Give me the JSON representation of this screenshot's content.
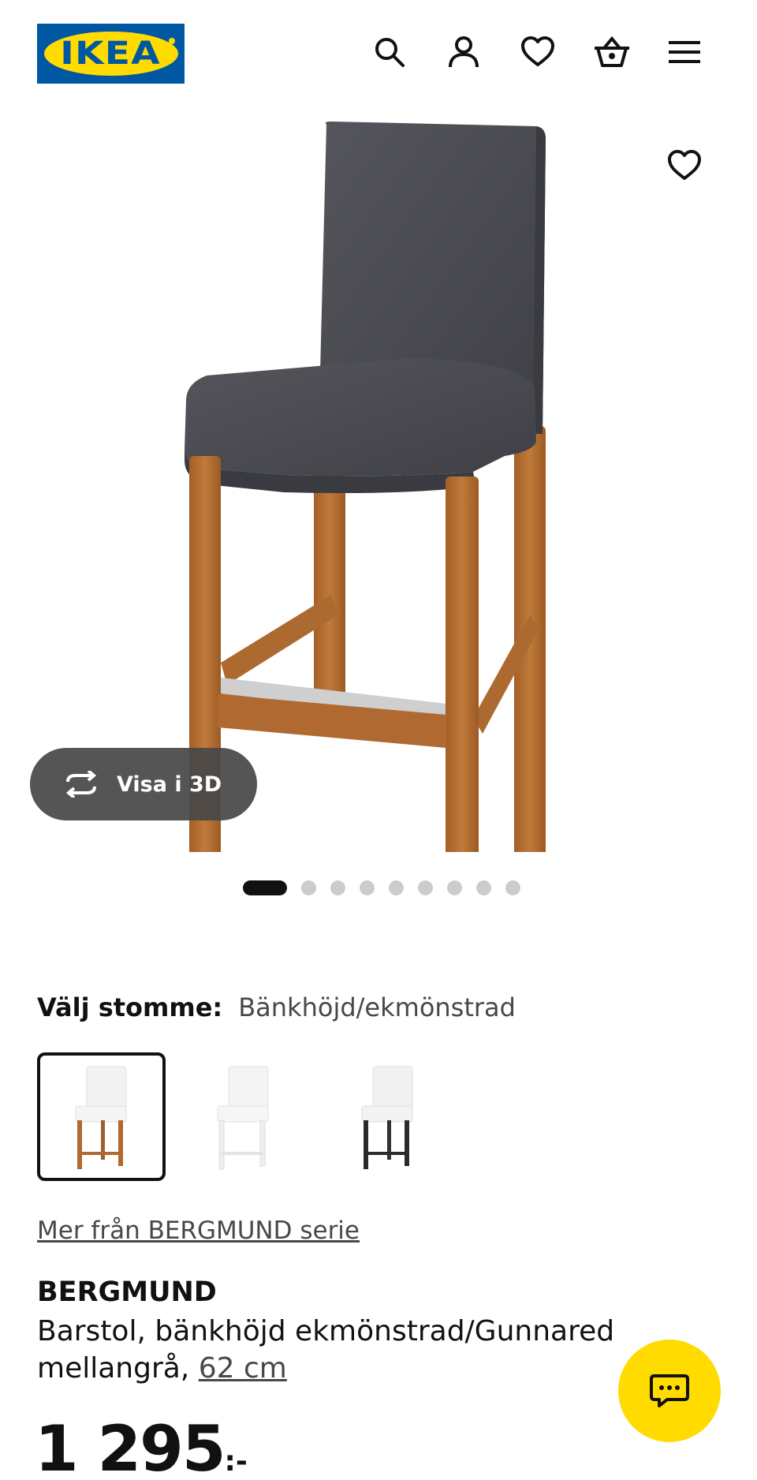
{
  "header": {
    "logo_text": "IKEA",
    "icons": [
      "search-icon",
      "account-icon",
      "heart-icon",
      "basket-icon",
      "menu-icon"
    ]
  },
  "gallery": {
    "view_3d_label": "Visa i 3D",
    "image_count": 9,
    "active_index": 0
  },
  "variant": {
    "label": "Välj stomme:",
    "value": "Bänkhöjd/ekmönstrad",
    "options": [
      "Bänkhöjd/ekmönstrad",
      "vit",
      "svart"
    ],
    "selected_index": 0
  },
  "product": {
    "series_link": "Mer från BERGMUND serie",
    "name": "BERGMUND",
    "description": "Barstol, bänkhöjd ekmönstrad/Gunnared mellangrå,",
    "size": "62 cm",
    "price": "1 295",
    "price_suffix": ":-"
  },
  "colors": {
    "brand_blue": "#0058a3",
    "brand_yellow": "#ffdb00",
    "fabric": "#4a4b51",
    "wood": "#b06a31"
  }
}
